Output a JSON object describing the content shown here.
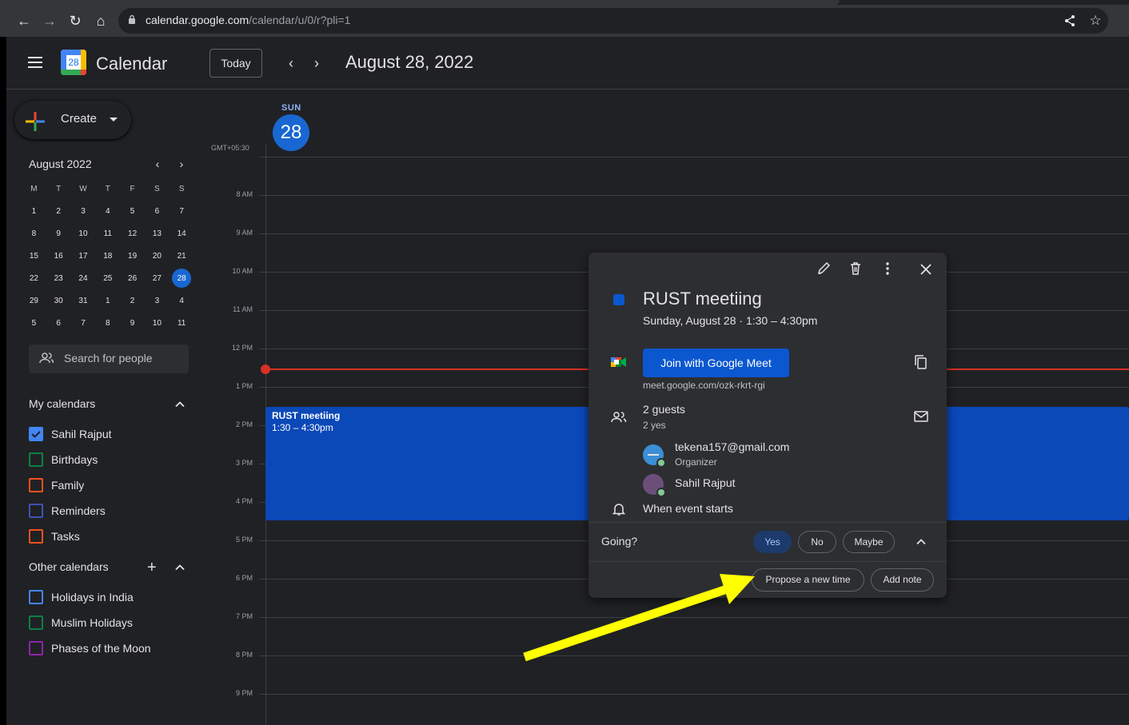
{
  "browser": {
    "url_host": "calendar.google.com",
    "url_path": "/calendar/u/0/r?pli=1"
  },
  "header": {
    "app_title": "Calendar",
    "logo_number": "28",
    "today_label": "Today",
    "date_title": "August 28, 2022"
  },
  "sidebar": {
    "create_label": "Create",
    "mini_calendar": {
      "month_label": "August 2022",
      "weekdays": [
        "M",
        "T",
        "W",
        "T",
        "F",
        "S",
        "S"
      ],
      "weeks": [
        [
          "1",
          "2",
          "3",
          "4",
          "5",
          "6",
          "7"
        ],
        [
          "8",
          "9",
          "10",
          "11",
          "12",
          "13",
          "14"
        ],
        [
          "15",
          "16",
          "17",
          "18",
          "19",
          "20",
          "21"
        ],
        [
          "22",
          "23",
          "24",
          "25",
          "26",
          "27",
          "28"
        ],
        [
          "29",
          "30",
          "31",
          "1",
          "2",
          "3",
          "4"
        ],
        [
          "5",
          "6",
          "7",
          "8",
          "9",
          "10",
          "11"
        ]
      ],
      "selected_day": "28"
    },
    "search_people_placeholder": "Search for people",
    "my_calendars_title": "My calendars",
    "my_calendars": [
      {
        "label": "Sahil Rajput",
        "color": "#4285f4",
        "checked": true
      },
      {
        "label": "Birthdays",
        "color": "#0b8043",
        "checked": false
      },
      {
        "label": "Family",
        "color": "#f4511e",
        "checked": false
      },
      {
        "label": "Reminders",
        "color": "#3f51b5",
        "checked": false
      },
      {
        "label": "Tasks",
        "color": "#f4511e",
        "checked": false
      }
    ],
    "other_calendars_title": "Other calendars",
    "other_calendars": [
      {
        "label": "Holidays in India",
        "color": "#4285f4",
        "checked": false
      },
      {
        "label": "Muslim Holidays",
        "color": "#0b8043",
        "checked": false
      },
      {
        "label": "Phases of the Moon",
        "color": "#8e24aa",
        "checked": false
      }
    ]
  },
  "day_view": {
    "day_name": "SUN",
    "day_number": "28",
    "timezone": "GMT+05:30",
    "hours": [
      "8 AM",
      "9 AM",
      "10 AM",
      "11 AM",
      "12 PM",
      "1 PM",
      "2 PM",
      "3 PM",
      "4 PM",
      "5 PM",
      "6 PM",
      "7 PM",
      "8 PM",
      "9 PM"
    ],
    "event": {
      "title": "RUST meetiing",
      "time": "1:30 – 4:30pm"
    }
  },
  "popover": {
    "title": "RUST meetiing",
    "subtitle": "Sunday, August 28  ·  1:30 – 4:30pm",
    "meet_button": "Join with Google Meet",
    "meet_link": "meet.google.com/ozk-rkrt-rgi",
    "guests_title": "2 guests",
    "guests_sub": "2 yes",
    "guests": [
      {
        "name": "tekena157@gmail.com",
        "role": "Organizer"
      },
      {
        "name": "Sahil Rajput",
        "role": ""
      }
    ],
    "reminder": "When event starts",
    "going_label": "Going?",
    "rsvp": {
      "yes": "Yes",
      "no": "No",
      "maybe": "Maybe"
    },
    "propose_label": "Propose a new time",
    "add_note_label": "Add note"
  },
  "colors": {
    "accent": "#1967d2",
    "event": "#0b48b8",
    "annotation_arrow": "#ffff00"
  }
}
